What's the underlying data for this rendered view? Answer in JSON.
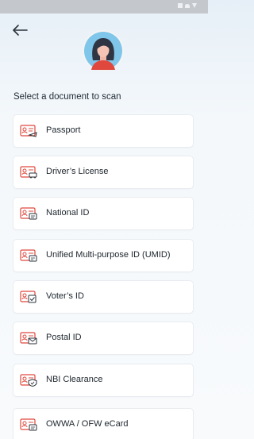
{
  "heading": "Select a document to scan",
  "documents": [
    {
      "label": "Passport",
      "icon": "passport-icon"
    },
    {
      "label": "Driver’s License",
      "icon": "drivers-license-icon"
    },
    {
      "label": "National ID",
      "icon": "national-id-icon"
    },
    {
      "label": "Unified Multi-purpose ID (UMID)",
      "icon": "umid-icon"
    },
    {
      "label": "Voter’s ID",
      "icon": "voters-id-icon"
    },
    {
      "label": "Postal ID",
      "icon": "postal-id-icon"
    },
    {
      "label": "NBI Clearance",
      "icon": "nbi-clearance-icon"
    },
    {
      "label": "OWWA / OFW eCard",
      "icon": "owwa-ofw-ecard-icon"
    }
  ],
  "colors": {
    "accent": "#e0483e",
    "text": "#20282f",
    "card_border": "#e8ecf0",
    "status_bar": "#c4c7cc"
  }
}
